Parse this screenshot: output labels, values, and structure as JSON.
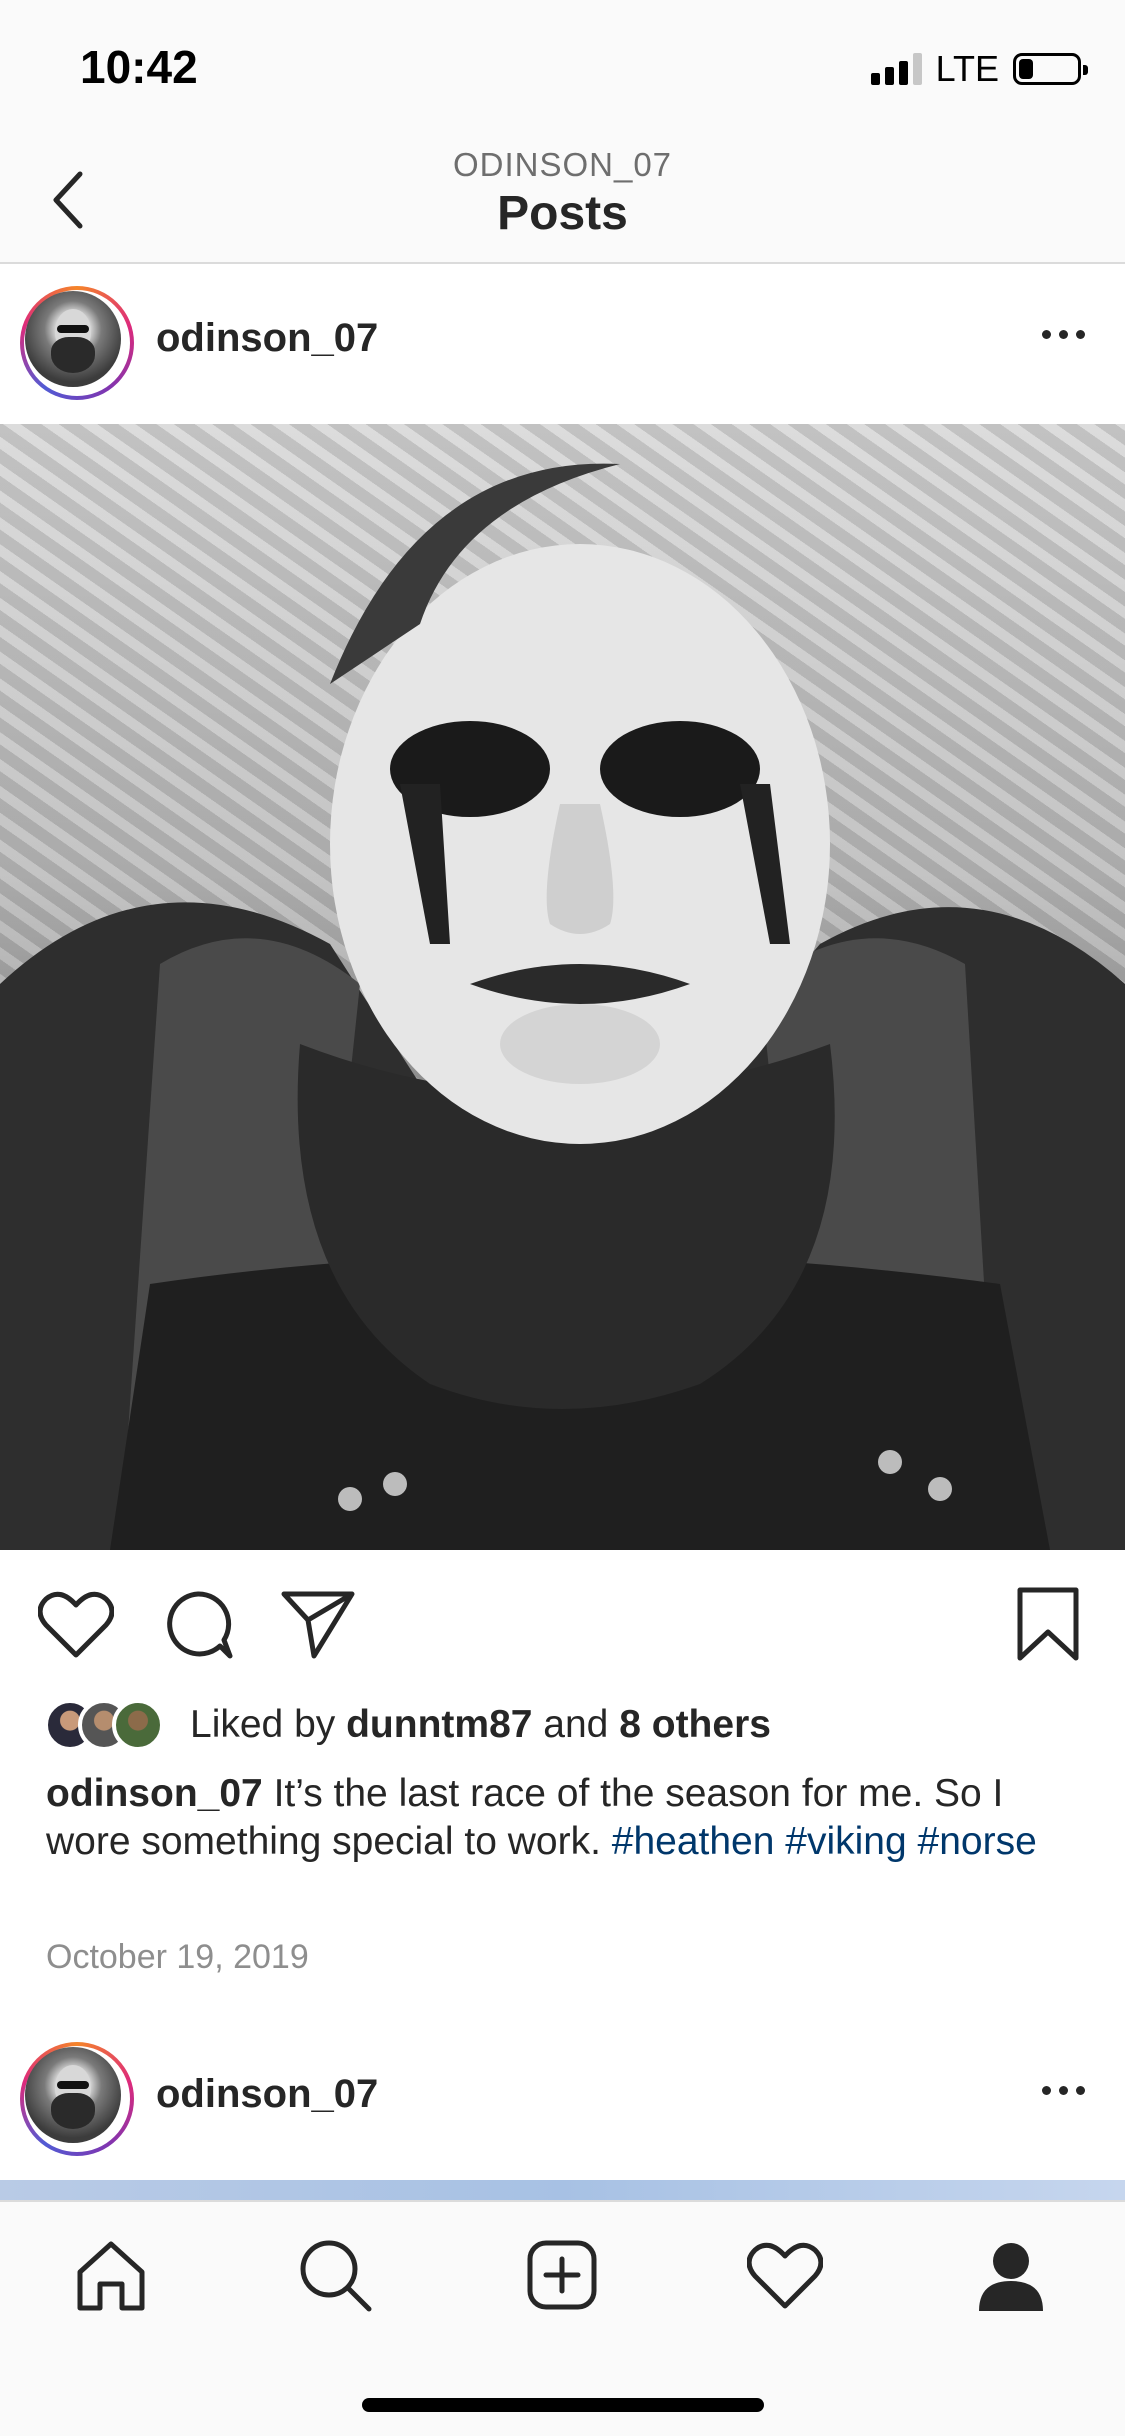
{
  "status_bar": {
    "time": "10:42",
    "network": "LTE",
    "signal_bars_active": 3,
    "battery_level": 0.25
  },
  "header": {
    "subtitle": "ODINSON_07",
    "title": "Posts",
    "back_icon": "chevron-left-icon"
  },
  "post": {
    "username": "odinson_07",
    "more_icon": "ellipsis-icon",
    "image_alt": "Black and white selfie of a bearded man with face paint",
    "actions": {
      "like_icon": "heart-outline-icon",
      "comment_icon": "comment-icon",
      "share_icon": "paper-plane-icon",
      "save_icon": "bookmark-outline-icon"
    },
    "likes": {
      "prefix": "Liked by",
      "user": "dunntm87",
      "conjunction": "and",
      "others": "8 others"
    },
    "caption": {
      "username": "odinson_07",
      "text": "It’s the last race of the season for me. So I wore something special to work.",
      "hashtags": [
        "#heathen",
        "#viking",
        "#norse"
      ]
    },
    "date": "October 19, 2019"
  },
  "next_post": {
    "username": "odinson_07"
  },
  "tab_bar": {
    "items": [
      "home-icon",
      "search-icon",
      "new-post-icon",
      "activity-heart-icon",
      "profile-icon"
    ]
  },
  "colors": {
    "hashtag": "#00376b",
    "text": "#262626",
    "secondary": "#8e8e8e",
    "ring_start": "#f58529",
    "ring_end": "#8134af"
  }
}
